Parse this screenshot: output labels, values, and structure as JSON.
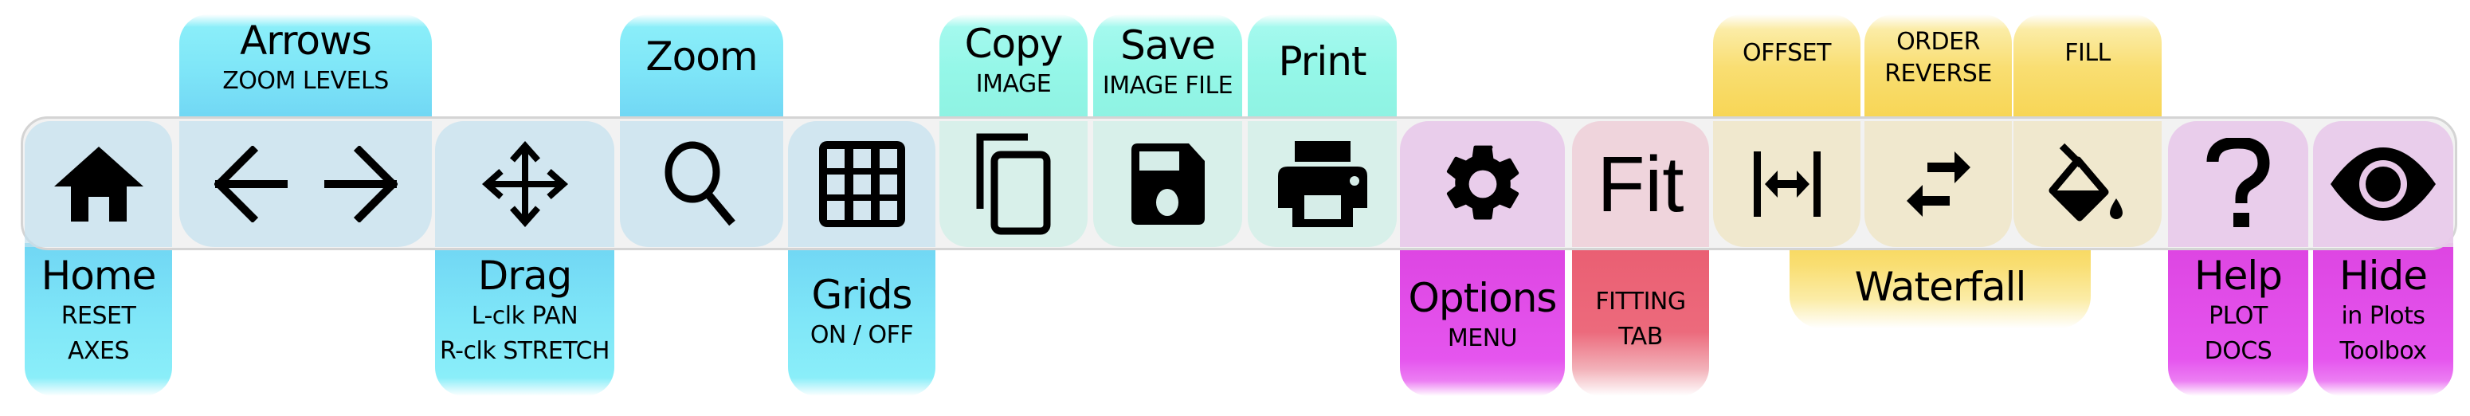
{
  "toolbar": {
    "home": {
      "title": "Home",
      "sub1": "RESET",
      "sub2": "AXES",
      "icon": "home-icon"
    },
    "arrows": {
      "title": "Arrows",
      "sub1": "ZOOM LEVELS",
      "icon_left": "arrow-left-icon",
      "icon_right": "arrow-right-icon"
    },
    "drag": {
      "title": "Drag",
      "sub1": "L-clk PAN",
      "sub2": "R-clk STRETCH",
      "icon": "move-icon"
    },
    "zoom": {
      "title": "Zoom",
      "icon": "magnifier-icon"
    },
    "grids": {
      "title": "Grids",
      "sub1": "ON / OFF",
      "icon": "grid-icon"
    },
    "copy": {
      "title": "Copy",
      "sub1": "IMAGE",
      "icon": "copy-icon"
    },
    "save": {
      "title": "Save",
      "sub1": "IMAGE FILE",
      "icon": "floppy-disk-icon"
    },
    "print": {
      "title": "Print",
      "icon": "printer-icon"
    },
    "options": {
      "title": "Options",
      "sub1": "MENU",
      "icon": "gear-icon"
    },
    "fit": {
      "button_text": "Fit",
      "sub1": "FITTING",
      "sub2": "TAB"
    },
    "offset": {
      "sub1": "OFFSET",
      "icon": "offset-icon"
    },
    "order": {
      "sub1": "ORDER",
      "sub2": "REVERSE",
      "icon": "swap-arrows-icon"
    },
    "fill": {
      "sub1": "FILL",
      "icon": "paint-bucket-icon"
    },
    "waterfall": {
      "title": "Waterfall"
    },
    "help": {
      "title": "Help",
      "sub1": "PLOT",
      "sub2": "DOCS",
      "icon": "question-mark-icon"
    },
    "hide": {
      "title": "Hide",
      "sub1": "in Plots",
      "sub2": "Toolbox",
      "icon": "eye-icon"
    }
  },
  "colors": {
    "navigation": "#7fe6f8",
    "export": "#95f7e8",
    "options": "#dd45e2",
    "fitting": "#ea5e72",
    "waterfall": "#f9de72",
    "bar_background": "#f2f2f2"
  }
}
